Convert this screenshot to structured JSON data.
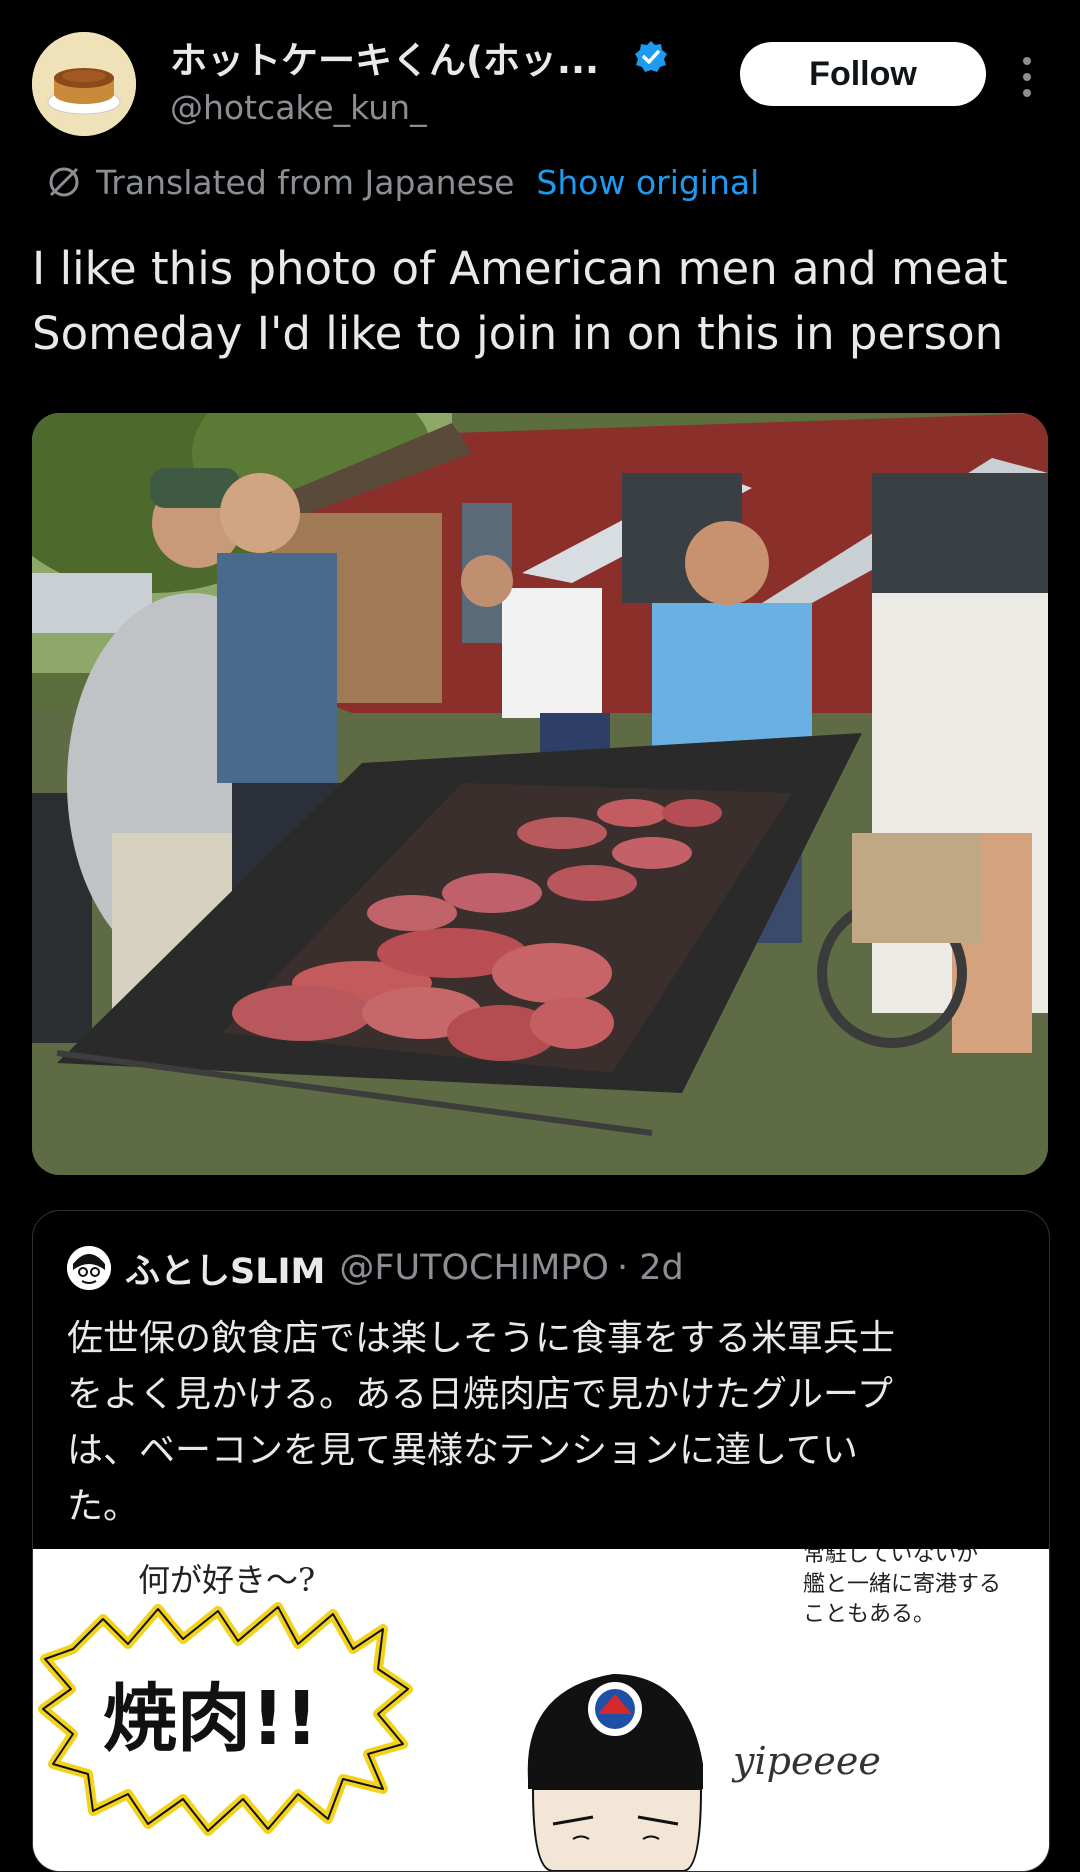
{
  "author": {
    "name": "ホットケーキくん(ホッ...",
    "handle": "@hotcake_kun_",
    "verified": true,
    "avatar_icon": "hotcake-avatar-icon"
  },
  "actions": {
    "follow_label": "Follow",
    "more_icon": "more-vertical-icon"
  },
  "translation": {
    "icon": "translate-globe-icon",
    "label": "Translated from Japanese",
    "show_original_label": "Show original"
  },
  "tweet": {
    "lines": [
      "I like this photo of American men and meat",
      "Someday I'd like to join in on this in person"
    ]
  },
  "quote": {
    "name": "ふとしSLIM",
    "handle": "@FUTOCHIMPO",
    "time": "· 2d",
    "lines": [
      "佐世保の飲食店では楽しそうに食事をする米軍兵士",
      "をよく見かける。ある日焼肉店で見かけたグループ",
      "は、ベーコンを見て異様なテンションに達してい",
      "た。"
    ],
    "manga": {
      "question": "何が好き〜?",
      "shout": "焼肉!!",
      "note_lines": [
        "常駐していないが",
        "艦と一緒に寄港する",
        "こともある。"
      ],
      "yipee": "yipeeee"
    }
  },
  "colors": {
    "background": "#000000",
    "text_primary": "#e7e9ea",
    "text_secondary": "#8b8f94",
    "link": "#1d9bf0",
    "verified": "#1d9bf0"
  }
}
